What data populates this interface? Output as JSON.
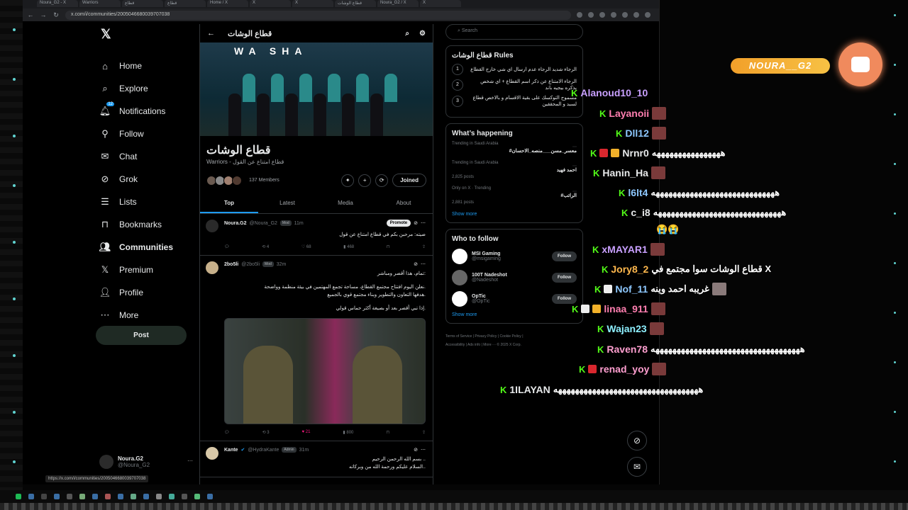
{
  "browser": {
    "tabs": [
      "Noura_G2 - X",
      "Warriors",
      "قطاع",
      "قطاع",
      "Home / X",
      "X",
      "X",
      "قطاع الوشات",
      "Noura_G2 / X",
      "X"
    ],
    "url": "x.com/i/communities/2005046680039707038",
    "status_url": "https://x.com/i/communities/2005046680039707038"
  },
  "nav": {
    "items": [
      {
        "label": "Home",
        "icon": "home-icon"
      },
      {
        "label": "Explore",
        "icon": "search-icon"
      },
      {
        "label": "Notifications",
        "icon": "bell-icon",
        "badge": "12"
      },
      {
        "label": "Follow",
        "icon": "add-person-icon"
      },
      {
        "label": "Chat",
        "icon": "mail-icon"
      },
      {
        "label": "Grok",
        "icon": "grok-icon"
      },
      {
        "label": "Lists",
        "icon": "list-icon"
      },
      {
        "label": "Bookmarks",
        "icon": "bookmark-icon"
      },
      {
        "label": "Communities",
        "icon": "people-icon"
      },
      {
        "label": "Premium",
        "icon": "x-icon"
      },
      {
        "label": "Profile",
        "icon": "person-icon"
      },
      {
        "label": "More",
        "icon": "more-icon"
      }
    ],
    "post": "Post",
    "account": {
      "name": "Noura.G2",
      "handle": "@Noura_G2"
    }
  },
  "community": {
    "header_title": "قطاع الوشات",
    "banner_text": "WA SHA",
    "name": "قطاع الوشات",
    "subtitle": "Warriors - قطاع امتناع عن القول",
    "members": "137 Members",
    "joined": "Joined",
    "tabs": [
      "Top",
      "Latest",
      "Media",
      "About"
    ]
  },
  "tweets": [
    {
      "name": "Noura.G2",
      "handle": "@Noura_G2",
      "role": "Mod",
      "time": "11m",
      "promote": "Promote",
      "body": "صيته: مرحبن بكم في قطاع امتناع عن قول",
      "replies": "",
      "retweets": "4",
      "likes": "68",
      "views": "468"
    },
    {
      "name": "2bo5li",
      "handle": "@2bo5li",
      "role": "Mod",
      "time": "32m",
      "lines": [
        "تمام، هذا أقصر ومباشر:",
        "نعلن اليوم افتتاح مجتمع القطاع، مساحة تجمع المهتمين في بيئة منظمة وواضحة.",
        "هدفها التعاون والتطوير وبناء مجتمع قوي بالجميع.",
        "إذا تبي أقصر بعد أو بصيغة أكثر حماس قولي."
      ],
      "replies": "",
      "retweets": "3",
      "likes": "21",
      "views": "800"
    },
    {
      "name": "Kante",
      "handle": "@HydraKante",
      "role": "Admin",
      "time": "31m",
      "lines": [
        "بسم الله الرحمن الرحيم ..",
        "السلام عليكم ورحمة الله من وبركاته.."
      ]
    }
  ],
  "sidebar": {
    "search_placeholder": "Search",
    "rules_title": "قطاع الوشات Rules",
    "rules": [
      {
        "n": "1",
        "text": "الرجاء شديد الرجاء عدم ارسال اي شي خارج القطاع"
      },
      {
        "n": "2",
        "text": "الرجاء الامتناع عن ذكر اسم القطاع + اي شخص يذكره بيجيه باند"
      },
      {
        "n": "3",
        "text": "مسموح التوكسك على بقية الاقسام و بالاخص قطاع لسبد و المحققين"
      }
    ],
    "happening_title": "What’s happening",
    "trends": [
      {
        "ctx": "Trending in Saudi Arabia",
        "name": "#معسر_مسن___منصه_الاحسان",
        "count": ""
      },
      {
        "ctx": "Trending in Saudi Arabia",
        "name": "احمد فهيد",
        "count": "2,825 posts"
      },
      {
        "ctx": "Only on X · Trending",
        "name": "#الراتب",
        "count": "2,881 posts"
      }
    ],
    "show_more": "Show more",
    "wtf_title": "Who to follow",
    "follows": [
      {
        "name": "MSI Gaming",
        "handle": "@msigaming",
        "btn": "Follow"
      },
      {
        "name": "100T Nadeshot",
        "handle": "@Nadeshot",
        "btn": "Follow"
      },
      {
        "name": "OpTic",
        "handle": "@OpTic",
        "btn": "Follow"
      }
    ],
    "footer": [
      "Terms of Service",
      "Privacy Policy",
      "Cookie Policy",
      "Accessibility",
      "Ads info",
      "More ···",
      "© 2025 X Corp."
    ]
  },
  "overlay": {
    "streamer": "NOURA__G2",
    "chat": [
      {
        "user": "Alanoud10_10",
        "msg": "",
        "color": "#c9a0ff"
      },
      {
        "user": "Layanoii",
        "msg": "",
        "color": "#ff7fb0"
      },
      {
        "user": "Dll12",
        "msg": "",
        "color": "#8ec8ff"
      },
      {
        "user": "Nrnr0",
        "msg": "ههههههههههههههههه",
        "color": "#ffffff"
      },
      {
        "user": "Hanin_Ha",
        "msg": "",
        "color": "#ffffff"
      },
      {
        "user": "l6lt4",
        "msg": "هههههههههههههههههههههههههههههه",
        "color": "#8ec8ff"
      },
      {
        "user": "c_i8",
        "msg": "ههههههههههههههههههههههههههههههه",
        "color": "#ffffff"
      },
      {
        "user": "",
        "msg": "😭😭",
        "color": "#ffffff"
      },
      {
        "user": "xMAYAR1",
        "msg": "",
        "color": "#c9a0ff"
      },
      {
        "user": "Jory8_2",
        "msg": "قطاع الوشات سوا مجتمع في X",
        "color": "#ffb84d"
      },
      {
        "user": "Nof_11",
        "msg": "غريبه احمد وينه",
        "color": "#8ec8ff"
      },
      {
        "user": "linaa_911",
        "msg": "",
        "color": "#ff7fb0"
      },
      {
        "user": "Wajan23",
        "msg": "",
        "color": "#8ef0ff"
      },
      {
        "user": "Raven78",
        "msg": "هههههههههههههههههههههههههههههههههههه",
        "color": "#ff9fd0"
      },
      {
        "user": "renad_yoy",
        "msg": "",
        "color": "#ff9fd0"
      },
      {
        "user": "1ILAYAN",
        "msg": "ههههههههههههههههههههههههههههههههههه",
        "color": "#ffffff"
      }
    ]
  }
}
